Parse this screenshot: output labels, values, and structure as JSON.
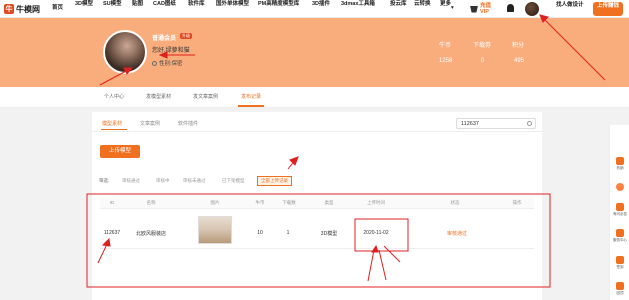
{
  "nav": {
    "logo": "牛模网",
    "items": [
      "首页",
      "3D模型",
      "SU模型",
      "贴图",
      "CAD图纸",
      "软件库",
      "国外单体模型",
      "PM高精度模型库",
      "3D插件",
      "3dmax工具箱",
      "投云库",
      "云转换",
      "更多"
    ],
    "vip_label": "充值VIP",
    "personal_label": "找人做设计",
    "upload_label": "上传赚钱"
  },
  "profile": {
    "username": "普通会员",
    "badge": "升级",
    "greeting": "您好,绿萝和猫",
    "gender": "性别:保密",
    "stats": [
      {
        "label": "牛币",
        "value": "1258"
      },
      {
        "label": "下载券",
        "value": "0"
      },
      {
        "label": "积分",
        "value": "495"
      }
    ]
  },
  "tabs": [
    "个人中心",
    "发模型素材",
    "发文章案例",
    "发布记录"
  ],
  "active_tab": 3,
  "subtabs": [
    "模型素材",
    "文章案例",
    "软件插件"
  ],
  "search_value": "112637",
  "upload_button": "上传模型",
  "filter": {
    "label": "筛选:",
    "options": [
      "审核通过",
      "审核中",
      "审核未通过",
      "已下架模型",
      "全部上传记录"
    ]
  },
  "table": {
    "headers": [
      "ID",
      "名称",
      "图片",
      "牛币",
      "下载数",
      "类型",
      "上传时间",
      "状态",
      "操作"
    ],
    "rows": [
      [
        "112637",
        "北欧风服装店",
        "",
        "10",
        "1",
        "3D模型",
        "2020-11-02",
        "审核通过",
        ""
      ]
    ]
  },
  "side_bar": [
    "热销",
    "",
    "有问必答",
    "服务中心",
    "签到",
    "回顶"
  ],
  "colors": {
    "accent": "#f07020",
    "banner": "#f9ad7d",
    "annotation": "#e02020"
  }
}
